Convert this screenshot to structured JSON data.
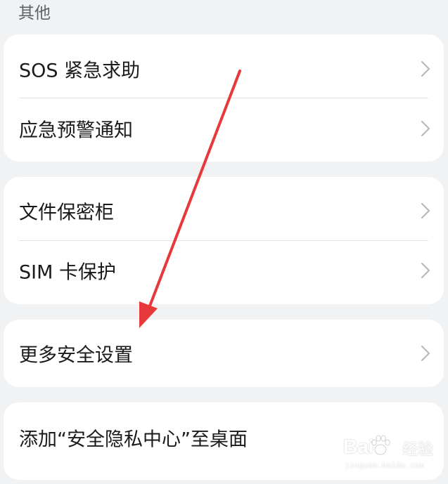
{
  "section": {
    "header": "其他"
  },
  "cards": [
    {
      "rows": [
        {
          "label": "SOS 紧急求助",
          "icon": "chevron-right-icon"
        },
        {
          "label": "应急预警通知",
          "icon": "chevron-right-icon"
        }
      ]
    },
    {
      "rows": [
        {
          "label": "文件保密柜",
          "icon": "chevron-right-icon"
        },
        {
          "label": "SIM 卡保护",
          "icon": "chevron-right-icon"
        }
      ]
    },
    {
      "rows": [
        {
          "label": "更多安全设置",
          "icon": "chevron-right-icon"
        }
      ]
    },
    {
      "rows": [
        {
          "label": "添加“安全隐私中心”至桌面"
        }
      ]
    }
  ],
  "annotation": {
    "arrow_color": "#e8393a",
    "target": "更多安全设置"
  },
  "watermark": {
    "brand": "Bai",
    "sub": "经验",
    "url": "jingyan.baidu.com"
  },
  "colors": {
    "background": "#f1f2f4",
    "card": "#ffffff",
    "text": "#1a1a1a",
    "chevron": "#b9b9bd"
  }
}
